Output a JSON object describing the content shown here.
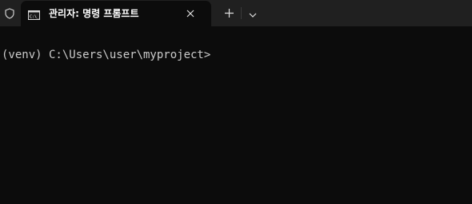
{
  "window": {
    "tab_title": "관리자: 명령 프롬프트",
    "tab_icon": "terminal-icon",
    "shield_icon": "shield-icon",
    "close_icon": "close-icon",
    "new_tab_icon": "plus-icon",
    "dropdown_icon": "chevron-down-icon"
  },
  "terminal": {
    "prompt": "(venv) C:\\Users\\user\\myproject>"
  },
  "colors": {
    "titlebar_bg": "#202020",
    "terminal_bg": "#0c0c0c",
    "text": "#cccccc",
    "tab_title": "#ffffff"
  }
}
